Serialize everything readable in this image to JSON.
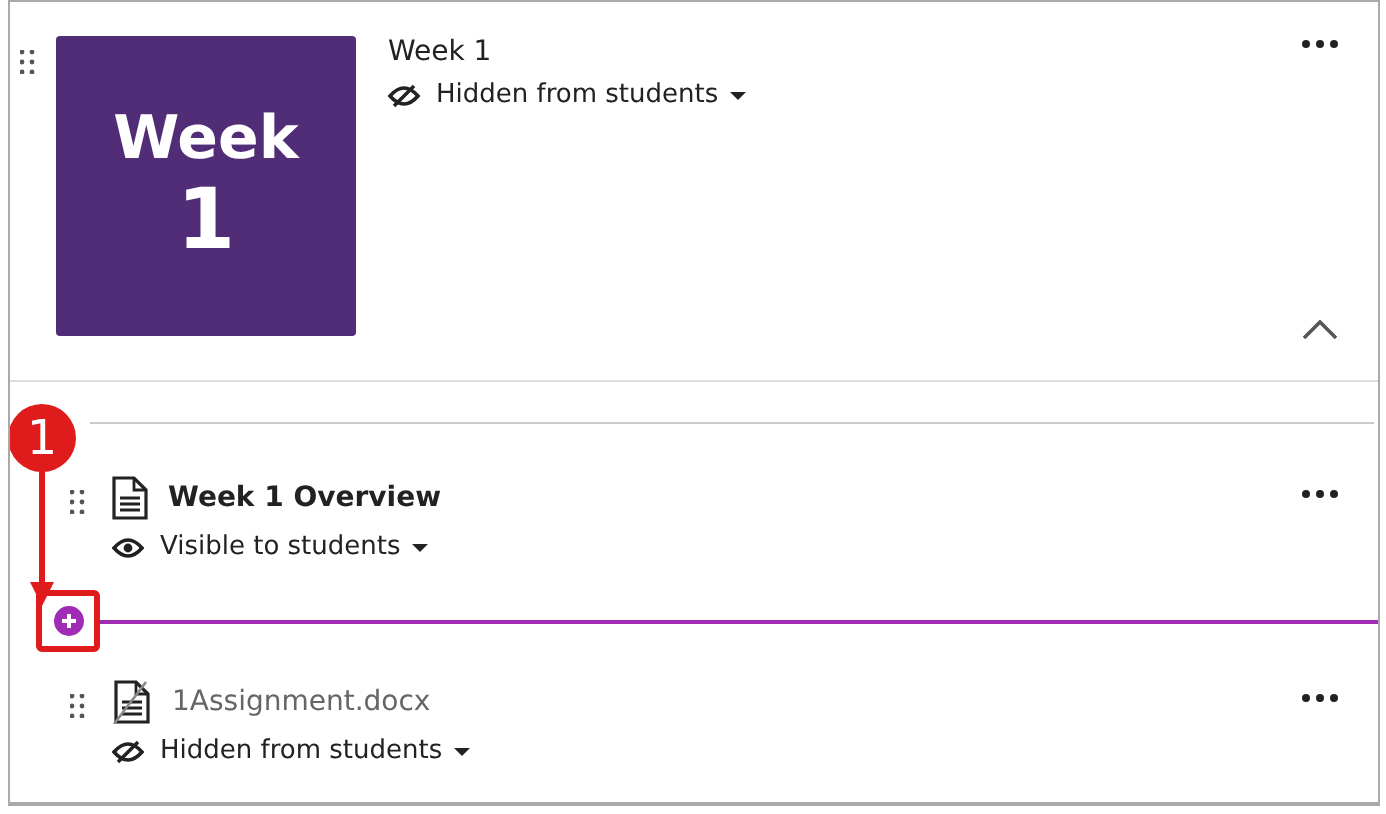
{
  "module": {
    "title": "Week 1",
    "thumbnail": {
      "line_1": "Week",
      "line_2": "1"
    },
    "visibility": {
      "label": "Hidden from students",
      "visible": false
    },
    "expanded": true
  },
  "items": [
    {
      "title": "Week 1 Overview",
      "visibility": {
        "label": "Visible to students",
        "visible": true
      },
      "insert_line_after": true
    },
    {
      "title": "1Assignment.docx",
      "visibility": {
        "label": "Hidden from students",
        "visible": false
      },
      "insert_line_after": false
    }
  ],
  "callout": {
    "number": "1"
  }
}
